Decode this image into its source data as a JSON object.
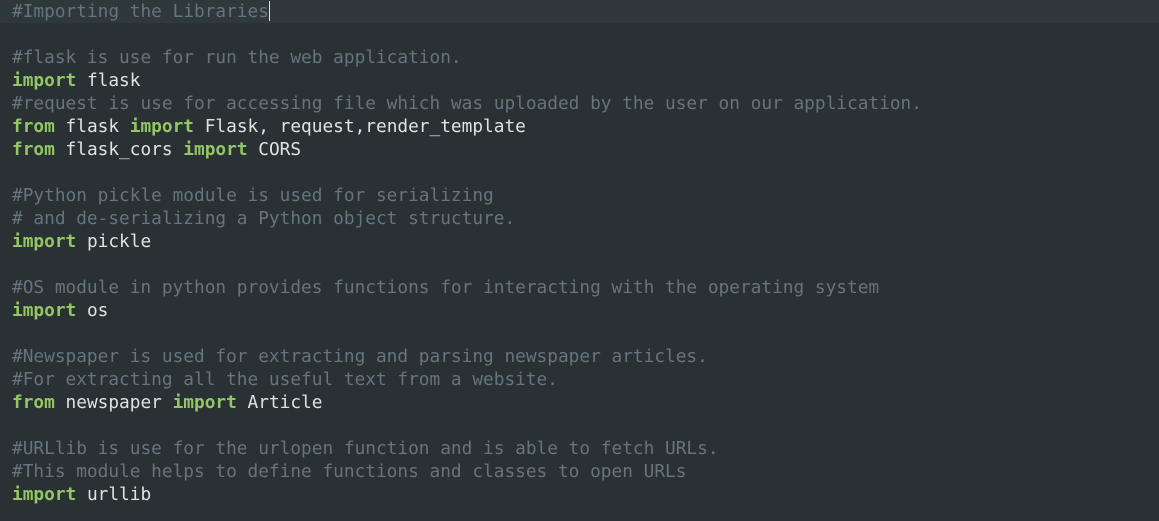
{
  "editor": {
    "lines": [
      {
        "comment": "#Importing the Libraries"
      },
      {},
      {
        "comment": "#flask is use for run the web application."
      },
      {
        "kw1": "import",
        "t1": " flask"
      },
      {
        "comment": "#request is use for accessing file which was uploaded by the user on our application."
      },
      {
        "kw1": "from",
        "t1": " flask ",
        "kw2": "import",
        "t2": " Flask, request,render_template"
      },
      {
        "kw1": "from",
        "t1": " flask_cors ",
        "kw2": "import",
        "t2": " CORS"
      },
      {},
      {
        "comment": "#Python pickle module is used for serializing"
      },
      {
        "comment": "# and de-serializing a Python object structure."
      },
      {
        "kw1": "import",
        "t1": " pickle"
      },
      {},
      {
        "comment": "#OS module in python provides functions for interacting with the operating system"
      },
      {
        "kw1": "import",
        "t1": " os"
      },
      {},
      {
        "comment": "#Newspaper is used for extracting and parsing newspaper articles."
      },
      {
        "comment": "#For extracting all the useful text from a website."
      },
      {
        "kw1": "from",
        "t1": " newspaper ",
        "kw2": "import",
        "t2": " Article"
      },
      {},
      {
        "comment": "#URLlib is use for the urlopen function and is able to fetch URLs."
      },
      {
        "comment": "#This module helps to define functions and classes to open URLs"
      },
      {
        "kw1": "import",
        "t1": " urllib"
      }
    ]
  },
  "colors": {
    "background": "#293134",
    "current_line": "#2f393c",
    "comment": "#66747b",
    "keyword": "#93c763",
    "text": "#e0e2e4"
  }
}
